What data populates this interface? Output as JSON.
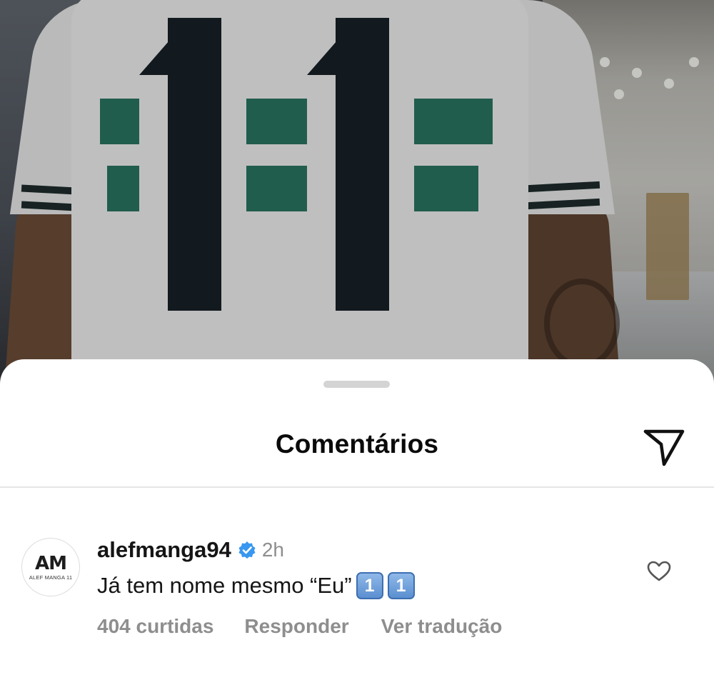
{
  "photo": {
    "alt_icon": "jersey-photo",
    "jersey_number": "11",
    "colors": {
      "jersey": "#e9e9e9",
      "stripe": "#1f6b57",
      "number": "#172026"
    }
  },
  "sheet": {
    "title": "Comentários",
    "share_icon": "paper-plane-icon"
  },
  "comment": {
    "avatar": {
      "monogram": "AM",
      "subtitle": "ALEF MANGA 11"
    },
    "username": "alefmanga94",
    "verified": true,
    "time": "2h",
    "text": "Já tem nome mesmo “Eu”",
    "emoji_keycaps": [
      "1",
      "1"
    ],
    "likes": "404 curtidas",
    "reply_label": "Responder",
    "translate_label": "Ver tradução",
    "like_icon": "heart-outline-icon"
  },
  "colors": {
    "verified_blue": "#3897f0",
    "secondary_text": "#8e8e8e",
    "primary_text": "#151515"
  }
}
